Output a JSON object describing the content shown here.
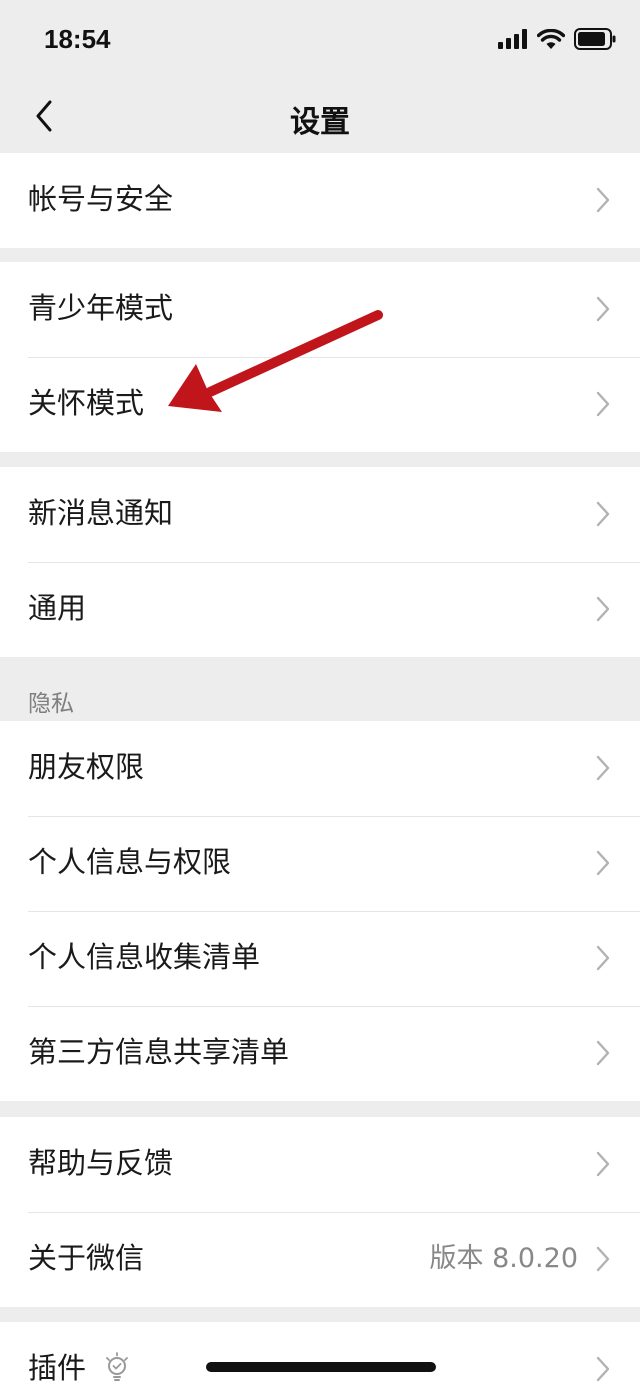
{
  "status_bar": {
    "time": "18:54",
    "icons": [
      "signal-icon",
      "wifi-icon",
      "battery-icon"
    ]
  },
  "nav": {
    "title": "设置",
    "back_icon": "back-icon"
  },
  "groups": [
    {
      "items": [
        {
          "label": "帐号与安全"
        }
      ]
    },
    {
      "items": [
        {
          "label": "青少年模式"
        },
        {
          "label": "关怀模式"
        }
      ]
    },
    {
      "items": [
        {
          "label": "新消息通知"
        },
        {
          "label": "通用"
        }
      ]
    },
    {
      "header": "隐私",
      "items": [
        {
          "label": "朋友权限"
        },
        {
          "label": "个人信息与权限"
        },
        {
          "label": "个人信息收集清单"
        },
        {
          "label": "第三方信息共享清单"
        }
      ]
    },
    {
      "items": [
        {
          "label": "帮助与反馈"
        },
        {
          "label": "关于微信",
          "value": "版本 8.0.20"
        }
      ]
    },
    {
      "items": [
        {
          "label": "插件",
          "icon": "plugin-bulb-icon"
        }
      ]
    }
  ],
  "colors": {
    "background": "#ededed",
    "cell": "#ffffff",
    "arrow": "#c0161b",
    "chevron": "#b2b2b2"
  }
}
